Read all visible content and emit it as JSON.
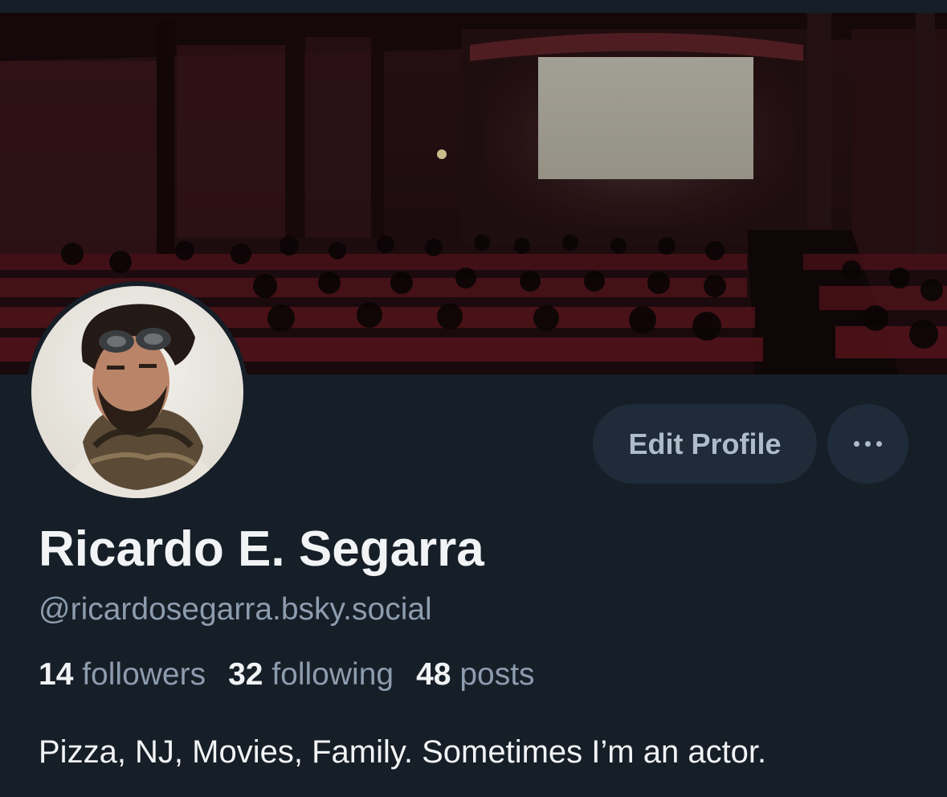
{
  "profile": {
    "display_name": "Ricardo E. Segarra",
    "handle": "@ricardosegarra.bsky.social",
    "bio": "Pizza, NJ, Movies, Family. Sometimes I’m an actor.",
    "banner_image": "movie-theater-audience-banner",
    "avatar_image": "man-with-goggles-and-scarf-avatar"
  },
  "stats": {
    "followers_count": "14",
    "followers_label": "followers",
    "following_count": "32",
    "following_label": "following",
    "posts_count": "48",
    "posts_label": "posts"
  },
  "actions": {
    "edit_profile_label": "Edit Profile",
    "more_icon": "ellipsis-horizontal-icon"
  },
  "colors": {
    "background": "#161e27",
    "button_bg": "#1f2b38",
    "button_text": "#aebbc9",
    "primary_text": "#f1f3f5",
    "secondary_text": "#8d9cae"
  }
}
